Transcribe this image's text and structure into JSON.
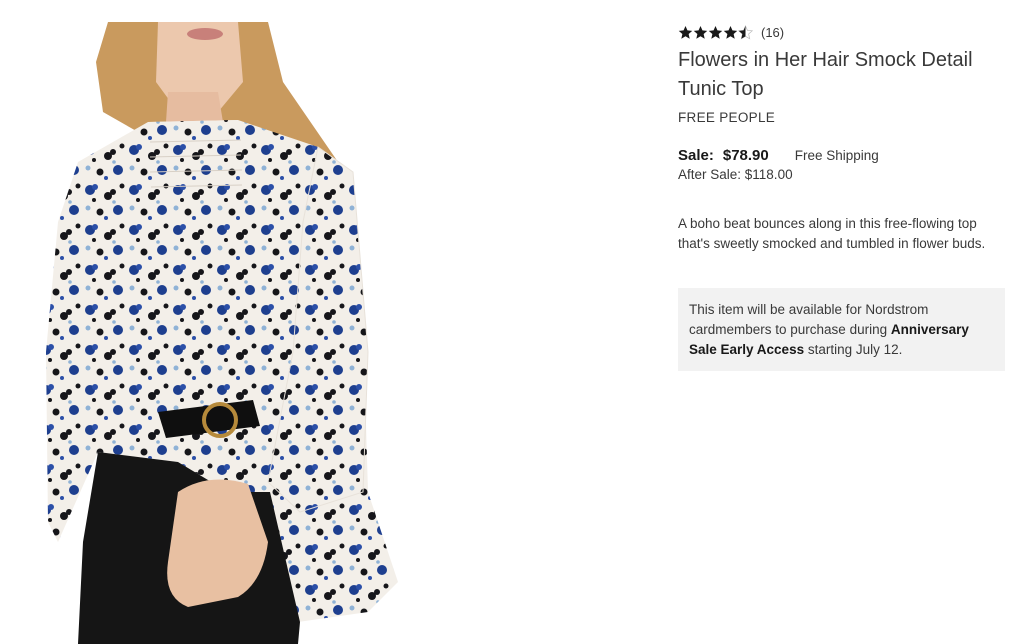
{
  "product": {
    "rating": {
      "stars": 4.5,
      "max_stars": 5,
      "count_label": "(16)"
    },
    "title": "Flowers in Her Hair Smock Detail Tunic Top",
    "brand": "FREE PEOPLE",
    "price": {
      "sale_label": "Sale:",
      "sale_price": "$78.90",
      "shipping": "Free Shipping",
      "after_sale": "After Sale: $118.00"
    },
    "description": "A boho beat bounces along in this free-flowing top that's sweetly smocked and tumbled in flower buds.",
    "notice": {
      "text_before": "This item will be available for Nordstrom cardmembers to purchase during ",
      "bold": "Anniversary Sale Early Access",
      "text_after": " starting July 12."
    },
    "image": {
      "icon": "product-photo",
      "print_colors": [
        "#1e3f8f",
        "#2b4fa8",
        "#16161a",
        "#f5f1ec",
        "#8fb2d6"
      ]
    }
  },
  "colors": {
    "text": "#393939",
    "star": "#191919",
    "notice_bg": "#f2f2f2"
  }
}
